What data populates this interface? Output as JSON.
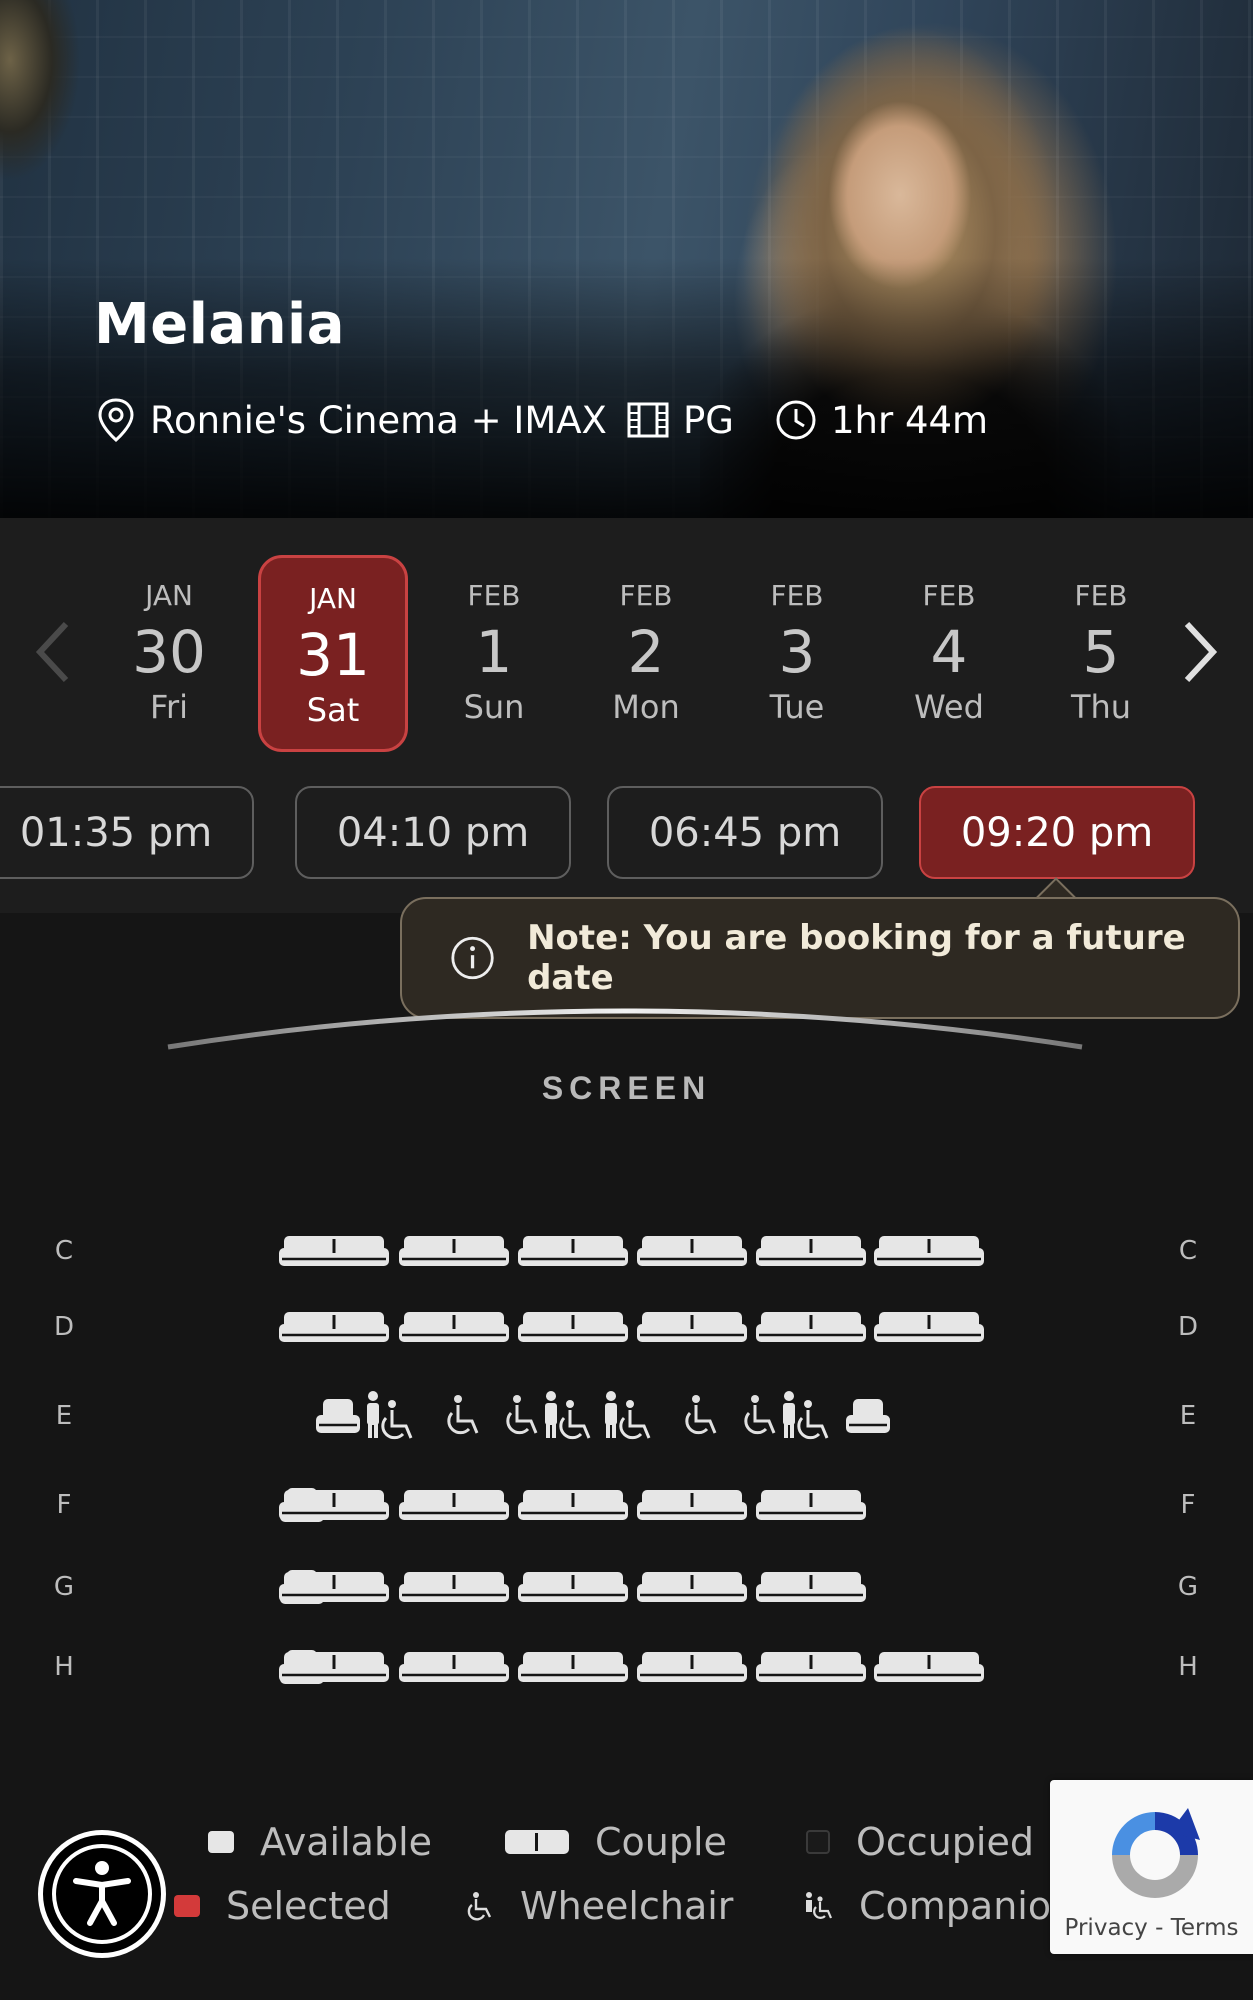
{
  "movie": {
    "title": "Melania",
    "cinema": "Ronnie's Cinema + IMAX",
    "rating": "PG",
    "runtime": "1hr 44m"
  },
  "dates": [
    {
      "month": "JAN",
      "day": "30",
      "weekday": "Fri",
      "selected": false
    },
    {
      "month": "JAN",
      "day": "31",
      "weekday": "Sat",
      "selected": true
    },
    {
      "month": "FEB",
      "day": "1",
      "weekday": "Sun",
      "selected": false
    },
    {
      "month": "FEB",
      "day": "2",
      "weekday": "Mon",
      "selected": false
    },
    {
      "month": "FEB",
      "day": "3",
      "weekday": "Tue",
      "selected": false
    },
    {
      "month": "FEB",
      "day": "4",
      "weekday": "Wed",
      "selected": false
    },
    {
      "month": "FEB",
      "day": "5",
      "weekday": "Thu",
      "selected": false
    }
  ],
  "times": [
    {
      "label": "01:35 pm",
      "selected": false
    },
    {
      "label": "04:10 pm",
      "selected": false
    },
    {
      "label": "06:45 pm",
      "selected": false
    },
    {
      "label": "09:20 pm",
      "selected": true
    }
  ],
  "note": "Note: You are booking for a future date",
  "screen_label": "SCREEN",
  "rows": [
    {
      "label": "C",
      "seats": [
        "couple",
        "couple",
        "couple",
        "couple",
        "couple",
        "couple"
      ]
    },
    {
      "label": "D",
      "seats": [
        "couple",
        "couple",
        "couple",
        "couple",
        "couple",
        "couple"
      ]
    },
    {
      "label": "E",
      "seats": [
        "single",
        "companion",
        "wheelchair",
        "wheelchair",
        "companion",
        "companion",
        "wheelchair",
        "wheelchair",
        "companion",
        "single"
      ]
    },
    {
      "label": "F",
      "seats": [
        "single",
        "couple",
        "couple",
        "couple",
        "couple",
        "couple"
      ]
    },
    {
      "label": "G",
      "seats": [
        "single",
        "couple",
        "couple",
        "couple",
        "couple",
        "couple"
      ]
    },
    {
      "label": "H",
      "seats": [
        "single",
        "couple",
        "couple",
        "couple",
        "couple",
        "couple",
        "couple"
      ]
    }
  ],
  "legend": {
    "available": "Available",
    "couple": "Couple",
    "occupied": "Occupied",
    "selected": "Selected",
    "wheelchair": "Wheelchair",
    "companion": "Companion"
  },
  "recaptcha": {
    "privacy": "Privacy",
    "sep": "-",
    "terms": "Terms"
  },
  "colors": {
    "accent": "#7a2121",
    "accent_border": "#c94242",
    "seat": "#e6e6e6",
    "selected": "#d33a3a",
    "background": "#151515"
  },
  "icons": [
    "location-pin-icon",
    "film-icon",
    "clock-icon",
    "chevron-left-icon",
    "chevron-right-icon",
    "info-icon",
    "accessibility-icon",
    "recaptcha-icon"
  ]
}
